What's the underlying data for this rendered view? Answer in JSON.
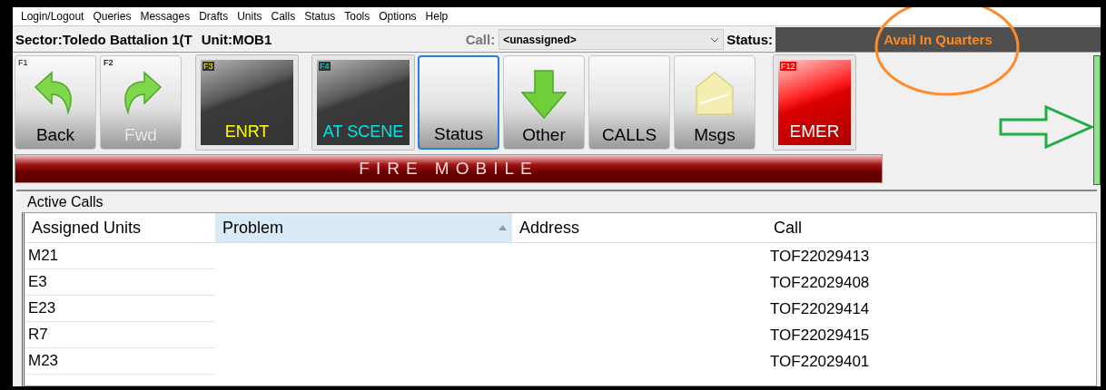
{
  "menu": [
    "Login/Logout",
    "Queries",
    "Messages",
    "Drafts",
    "Units",
    "Calls",
    "Status",
    "Tools",
    "Options",
    "Help"
  ],
  "header": {
    "sector": "Sector:Toledo Battalion 1(T",
    "unit": "Unit:MOB1",
    "call_label": "Call:",
    "call_value": "<unassigned>",
    "status_label": "Status:",
    "status_value": "Avail In Quarters"
  },
  "toolbar": [
    {
      "kind": "undo",
      "key": "F1",
      "label": "Back",
      "disabled": false,
      "focused": false
    },
    {
      "kind": "redo",
      "key": "F2",
      "label": "Fwd",
      "disabled": true,
      "focused": false
    },
    {
      "kind": "dark",
      "key": "F3",
      "label": "ENRT",
      "color": "#ffff00",
      "disabled": false,
      "focused": false
    },
    {
      "kind": "dark",
      "key": "F4",
      "label": "AT SCENE",
      "color": "#00e5e5",
      "disabled": false,
      "focused": false
    },
    {
      "kind": "plain",
      "label": "Status",
      "disabled": false,
      "focused": true
    },
    {
      "kind": "download",
      "label": "Other",
      "disabled": false,
      "focused": false
    },
    {
      "kind": "plain",
      "label": "CALLS",
      "disabled": false,
      "focused": false
    },
    {
      "kind": "mail",
      "label": "Msgs",
      "disabled": false,
      "focused": false
    },
    {
      "kind": "red",
      "key": "F12",
      "label": "EMER",
      "disabled": false,
      "focused": false
    }
  ],
  "banner": "FIRE MOBILE",
  "active_calls": {
    "title": "Active Calls",
    "columns": [
      {
        "label": "Assigned Units",
        "sorted": false
      },
      {
        "label": "Problem",
        "sorted": true
      },
      {
        "label": "Address",
        "sorted": false
      },
      {
        "label": "Call",
        "sorted": false
      }
    ],
    "rows": [
      {
        "assigned_units": "M21",
        "call": "TOF22029413"
      },
      {
        "assigned_units": "E3",
        "call": "TOF22029408"
      },
      {
        "assigned_units": "E23",
        "call": "TOF22029414"
      },
      {
        "assigned_units": "R7",
        "call": "TOF22029415"
      },
      {
        "assigned_units": "M23",
        "call": "TOF22029401"
      }
    ]
  }
}
